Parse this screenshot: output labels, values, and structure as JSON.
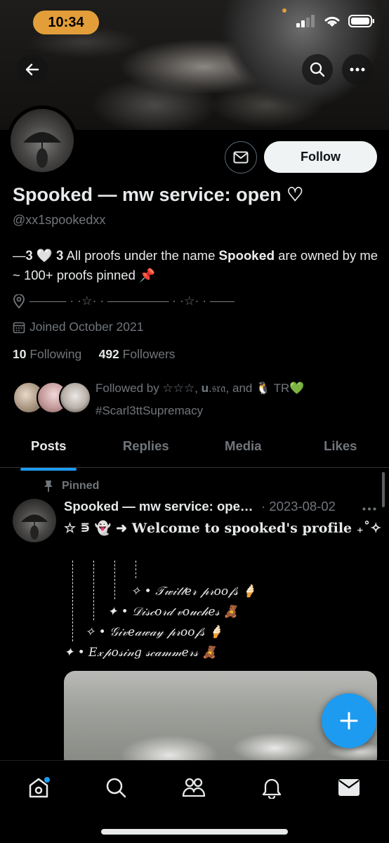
{
  "status_bar": {
    "time": "10:34"
  },
  "profile": {
    "name": "Spooked — mw service: open ♡",
    "handle": "@xx1spookedxx",
    "bio": "—𝟑 🤍 𝟑 All proofs under the name 𝐒𝐩𝐨𝐨𝐤𝐞𝐝 are owned by me ~ 100+ proofs pinned 📌",
    "location": "——— · ·☆· · ————— · ·☆· · ——",
    "joined": "Joined October 2021",
    "following_count": "10",
    "following_label": "Following",
    "followers_count": "492",
    "followers_label": "Followers",
    "followed_by": "Followed by ☆☆☆, 𝐮.𝔰𝔯𝔞, and 🐧 TR💚 #Scarl3ttSupremacy"
  },
  "actions": {
    "follow_label": "Follow"
  },
  "tabs": [
    {
      "label": "Posts"
    },
    {
      "label": "Replies"
    },
    {
      "label": "Media"
    },
    {
      "label": "Likes"
    }
  ],
  "post": {
    "pinned_label": "Pinned",
    "author": "Spooked — mw service: open ♡",
    "date": "2023-08-02",
    "line1": "☆ ⋾ 👻 ➜ 𝐖𝐞𝐥𝐜𝐨𝐦𝐞 𝐭𝐨 𝐬𝐩𝐨𝐨𝐤𝐞𝐝'𝐬 𝐩𝐫𝐨𝐟𝐢𝐥𝐞 ₊˚✧",
    "list": [
      "✧ • 𝒯𝓌𝒾𝓉𝓉𝑒𝓇 𝓅𝓇𝑜𝑜𝒻𝓈 🍦",
      "✦ • 𝒟𝒾𝓈𝒸𝑜𝓇𝒹 𝓋𝑜𝓊𝒸𝒽𝑒𝓈 🧸",
      "✧ • 𝒢𝒾𝓋𝑒𝒶𝓌𝒶𝓎 𝓅𝓇𝑜𝑜𝒻𝓈 🍦",
      "✦ • 𝐸𝓍𝓅𝑜𝓈𝒾𝓃𝑔 𝓈𝒸𝒶𝓂𝓂𝑒𝓇𝓈 🧸"
    ]
  },
  "colors": {
    "accent": "#1d9bf0",
    "status_pill": "#e39e3a",
    "muted": "#71767b"
  }
}
